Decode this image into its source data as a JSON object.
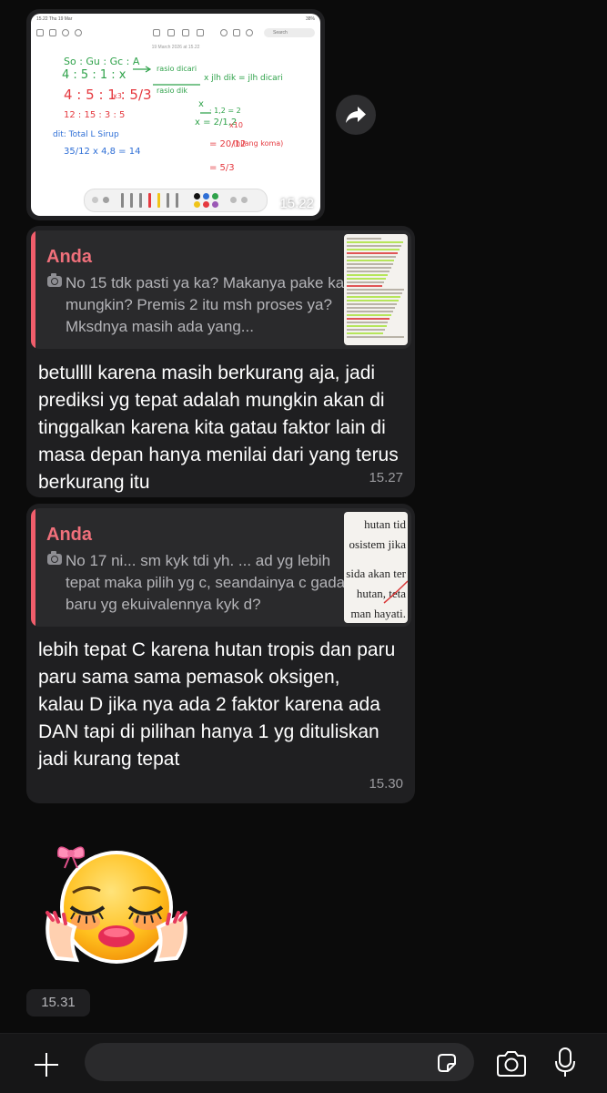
{
  "image_message": {
    "time": "15.22",
    "note": {
      "status_left": "15.22  Thu 19 Mar",
      "status_right": "38%",
      "search_placeholder": "Search",
      "date_line": "19 March 2026 at 15.22",
      "handwriting": [
        {
          "text": "So : Gu : Gc : A",
          "color": "g"
        },
        {
          "text": "4 : 5 : 1 : x",
          "color": "g"
        },
        {
          "text": "rasio dicari",
          "color": "g"
        },
        {
          "text": "rasio dik",
          "color": "g"
        },
        {
          "text": "x jlh dik = jlh dicari",
          "color": "g"
        },
        {
          "text": "4 : 5 : 1 : 5/3",
          "color": "r"
        },
        {
          "text": "x3",
          "color": "r"
        },
        {
          "text": "x",
          "color": "g"
        },
        {
          "text": "· 1,2 = 2",
          "color": "g"
        },
        {
          "text": "12 : 15 : 3 : 5",
          "color": "r"
        },
        {
          "text": "x = 2/1,2",
          "color": "g"
        },
        {
          "text": "x10",
          "color": "r"
        },
        {
          "text": "dit: Total L Sirup",
          "color": "b"
        },
        {
          "text": "= 20/12",
          "color": "r"
        },
        {
          "text": "(hilang koma)",
          "color": "r"
        },
        {
          "text": "35/12 x 4,8 = 14",
          "color": "b"
        },
        {
          "text": "= 5/3",
          "color": "r"
        }
      ]
    }
  },
  "messages": [
    {
      "quote": {
        "author": "Anda",
        "text": "No 15 tdk pasti ya ka? Makanya pake kata mungkin? Premis 2 itu msh proses ya? Mksdnya masih ada yang..."
      },
      "text": "betullll karena masih berkurang aja, jadi prediksi yg tepat adalah mungkin akan di tinggalkan karena kita gatau faktor lain di masa depan hanya menilai dari yang terus berkurang itu",
      "time": "15.27"
    },
    {
      "quote": {
        "author": "Anda",
        "text": "No 17 ni... sm kyk tdi yh. ... ad yg lebih tepat maka pilih yg c, seandainya c gada baru yg ekuivalennya kyk d?",
        "thumb_lines": [
          "hutan tid",
          "osistem jika",
          "sida akan ter",
          "hutan, teta",
          "man hayati."
        ]
      },
      "text": "lebih tepat C karena hutan tropis dan paru paru sama sama pemasok oksigen,\nkalau D jika nya ada 2 faktor karena ada DAN tapi di pilihan hanya 1 yg dituliskan jadi kurang tepat",
      "time": "15.30"
    }
  ],
  "sticker_time": "15.31",
  "input": {
    "placeholder": "",
    "value": ""
  },
  "icons": [
    "forward-icon",
    "camera-icon",
    "plus-icon",
    "sticker-icon",
    "microphone-icon"
  ],
  "colors": {
    "background": "#0b0b0b",
    "bubble": "#1f1f21",
    "quote_bg": "#2a2a2c",
    "quote_accent": "#f05d6b",
    "secondary_text": "#9b9b9f"
  }
}
